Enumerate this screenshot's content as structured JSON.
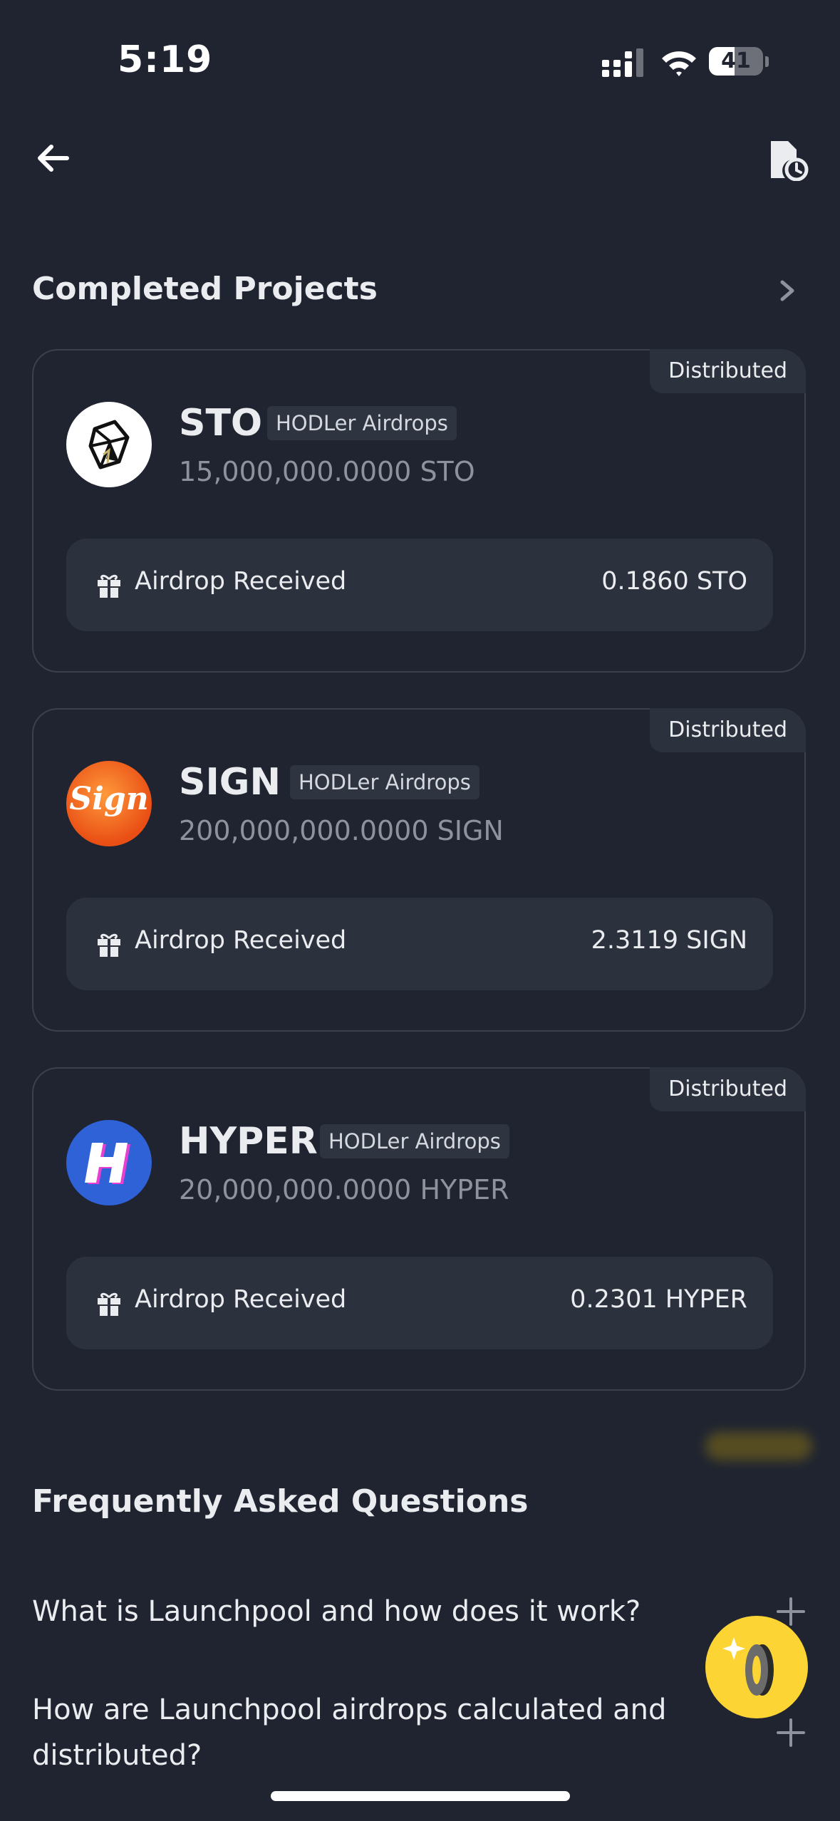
{
  "status_bar": {
    "time": "5:19",
    "battery_level": "41"
  },
  "header": {
    "back_icon": "arrow-left-icon",
    "history_icon": "document-clock-icon"
  },
  "completed": {
    "title": "Completed Projects",
    "projects": [
      {
        "name": "STO",
        "tag": "HODLer Airdrops",
        "total": "15,000,000.0000 STO",
        "status": "Distributed",
        "received_label": "Airdrop Received",
        "received_value": "0.1860 STO",
        "logo": "sto-logo"
      },
      {
        "name": "SIGN",
        "tag": "HODLer Airdrops",
        "total": "200,000,000.0000 SIGN",
        "status": "Distributed",
        "received_label": "Airdrop Received",
        "received_value": "2.3119 SIGN",
        "logo_text": "Sign"
      },
      {
        "name": "HYPER",
        "tag": "HODLer Airdrops",
        "total": "20,000,000.0000 HYPER",
        "status": "Distributed",
        "received_label": "Airdrop Received",
        "received_value": "0.2301 HYPER",
        "logo": "hyper-logo"
      }
    ]
  },
  "faq": {
    "title": "Frequently Asked Questions",
    "questions": [
      "What is Launchpool and how does it work?",
      "How are Launchpool airdrops calculated and distributed?"
    ]
  },
  "colors": {
    "background": "#1f2430",
    "card_inner": "#2b313d",
    "accent": "#fcd535",
    "muted_text": "#8d929c"
  }
}
